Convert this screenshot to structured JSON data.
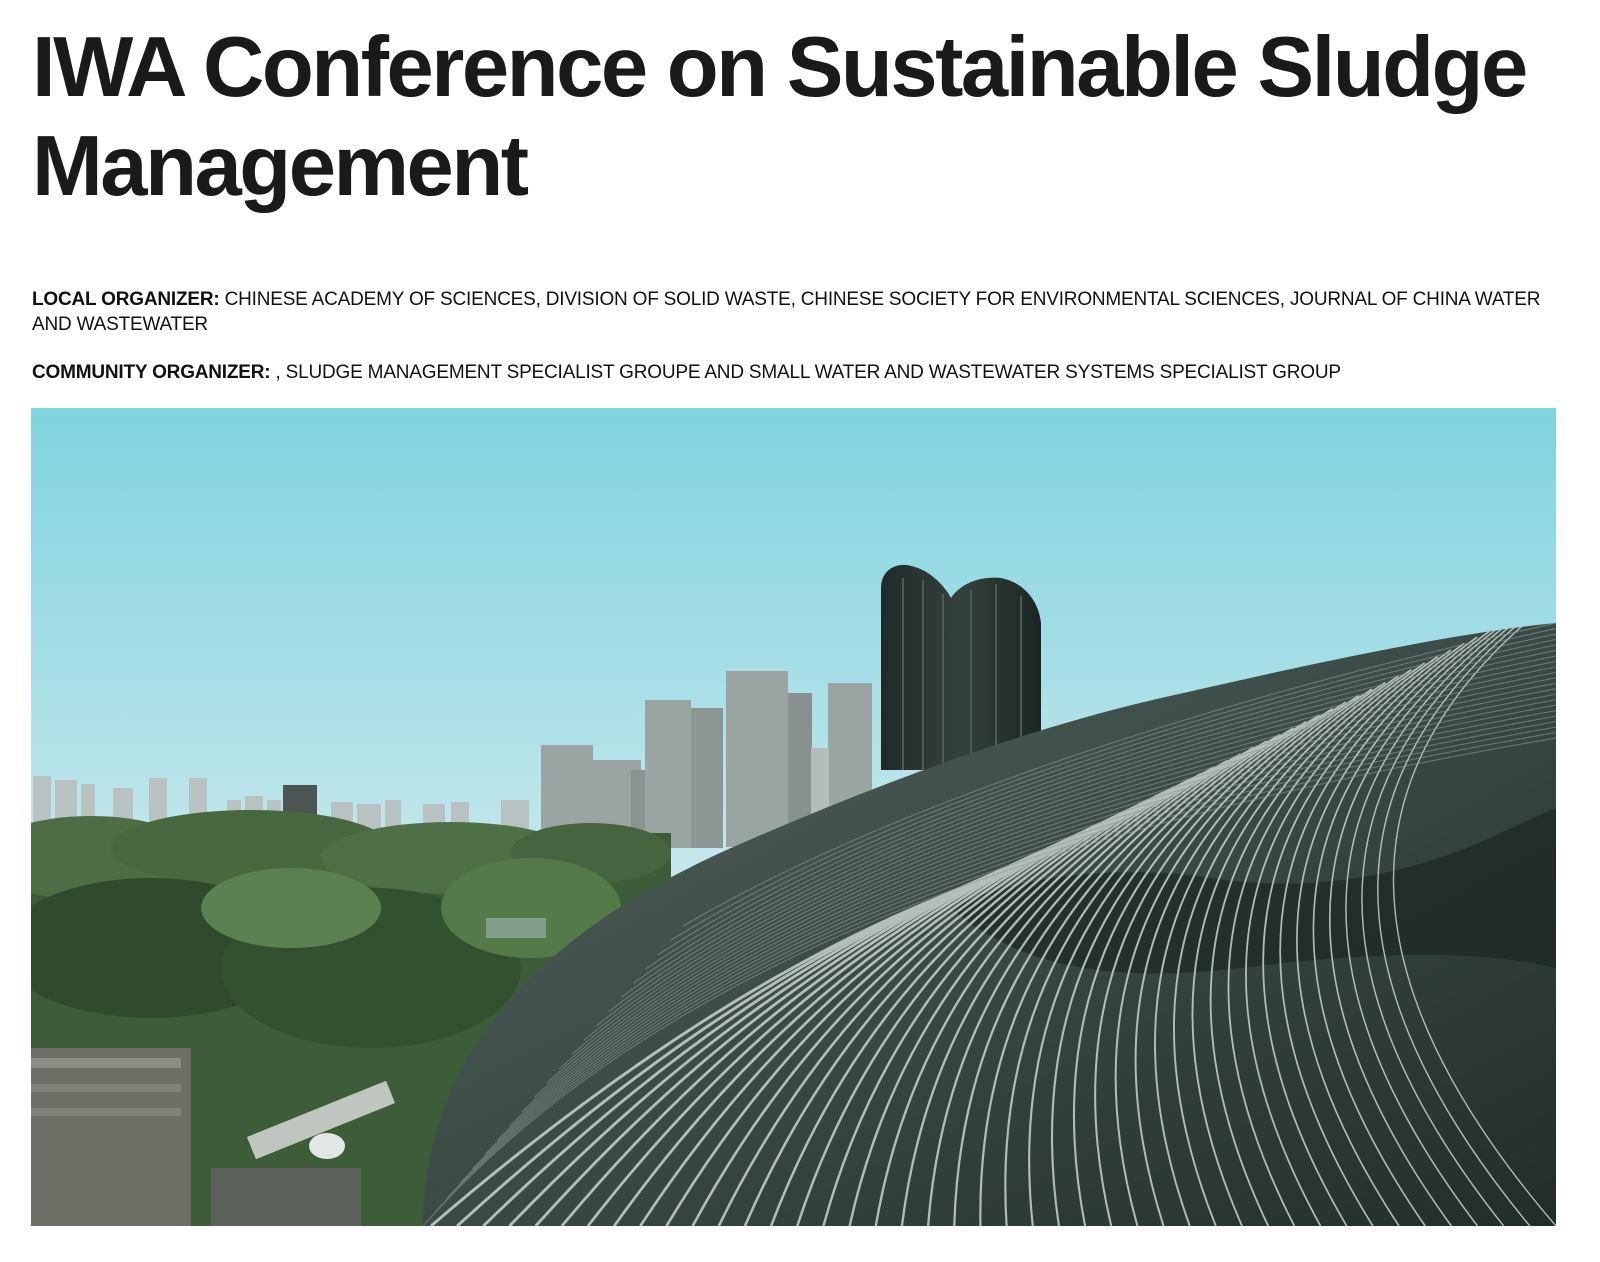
{
  "page": {
    "title": "IWA Conference on Sustainable Sludge Management"
  },
  "organizers": {
    "local": {
      "label": "LOCAL ORGANIZER:",
      "value": "CHINESE ACADEMY OF SCIENCES, DIVISION OF SOLID WASTE, CHINESE SOCIETY FOR ENVIRONMENTAL SCIENCES, JOURNAL OF CHINA WATER AND WASTEWATER"
    },
    "community": {
      "label": "COMMUNITY ORGANIZER:",
      "value": ", SLUDGE MANAGEMENT SPECIALIST GROUPE AND SMALL WATER AND WASTEWATER SYSTEMS SPECIALIST GROUP"
    }
  },
  "hero_image": {
    "subject": "city skyline with trees and a curved glass-and-steel lattice building",
    "colors": {
      "sky_top": "#7fd3df",
      "sky_bottom": "#dceef0",
      "trees": "#3f5e3a",
      "building": "#2c3a38",
      "ribs": "#c9d2cf"
    }
  }
}
